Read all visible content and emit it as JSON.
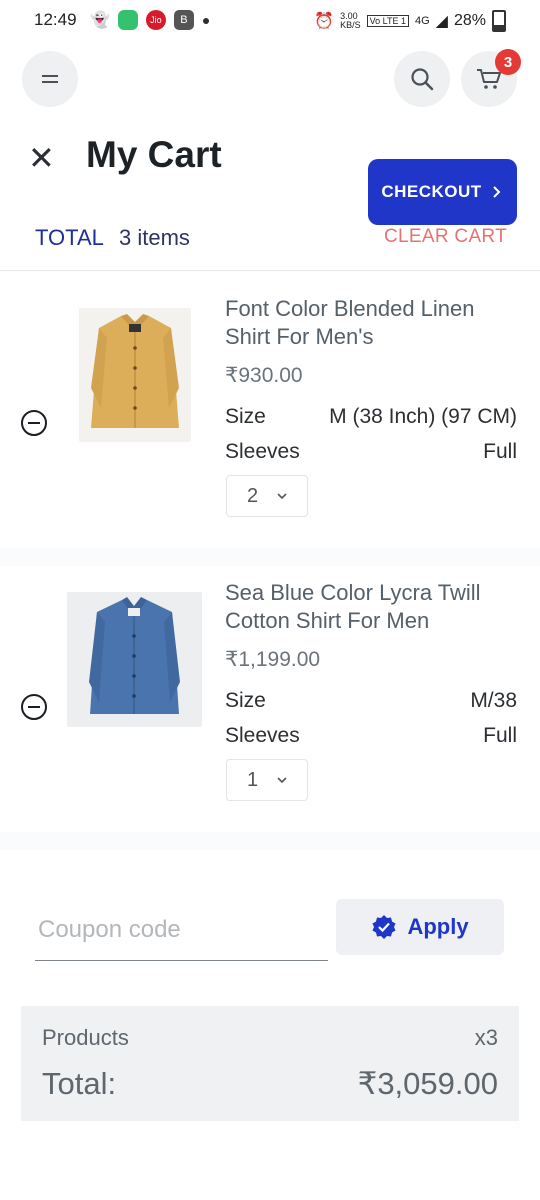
{
  "status_bar": {
    "time": "12:49",
    "network_speed": "3.00\nKB/S",
    "volte": "Vo LTE 1",
    "signal": "4G",
    "battery": "28%"
  },
  "header": {
    "cart_badge_count": "3",
    "title": "My Cart",
    "checkout_label": "CHECKOUT",
    "total_label": "TOTAL",
    "items_count": "3 items",
    "clear_cart_label": "CLEAR CART"
  },
  "cart": {
    "items": [
      {
        "name": "Font Color Blended Linen Shirt For Men's",
        "price": "₹930.00",
        "size_label": "Size",
        "size_value": "M (38 Inch) (97 CM)",
        "sleeves_label": "Sleeves",
        "sleeves_value": "Full",
        "quantity": "2",
        "color": "#dcae5a"
      },
      {
        "name": "Sea Blue Color Lycra Twill Cotton Shirt For Men",
        "price": "₹1,199.00",
        "size_label": "Size",
        "size_value": "M/38",
        "sleeves_label": "Sleeves",
        "sleeves_value": "Full",
        "quantity": "1",
        "color": "#4a74ad"
      }
    ]
  },
  "coupon": {
    "placeholder": "Coupon code",
    "value": "",
    "apply_label": "Apply"
  },
  "summary": {
    "products_label": "Products",
    "products_qty": "x3",
    "total_label": "Total:",
    "total_value": "₹3,059.00"
  },
  "colors": {
    "accent": "#1f36c9",
    "badge": "#e53935",
    "clear_cart": "#e57373"
  }
}
